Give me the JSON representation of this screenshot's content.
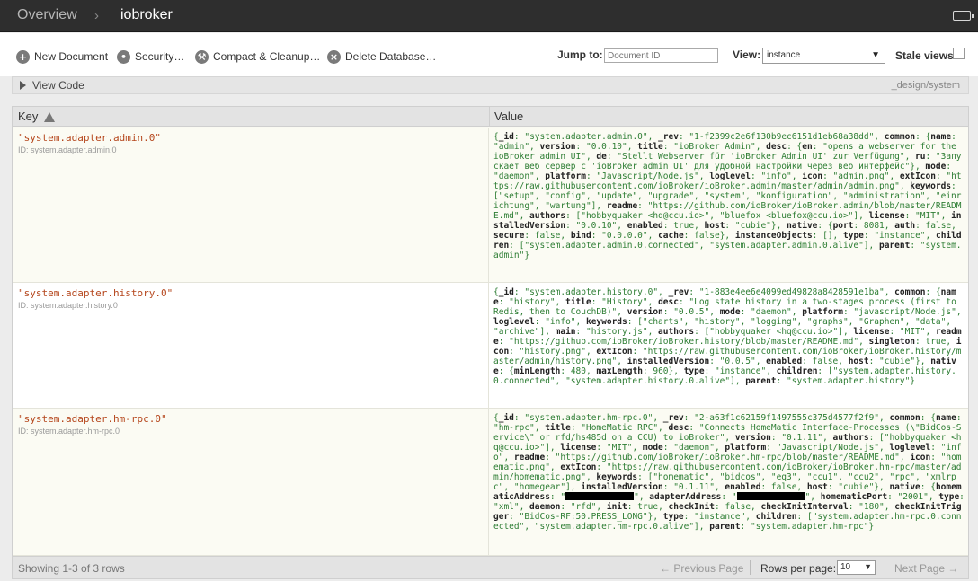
{
  "header": {
    "breadcrumb_root": "Overview",
    "separator": "›",
    "database": "iobroker"
  },
  "toolbar": {
    "new_document": "New Document",
    "security": "Security…",
    "compact": "Compact & Cleanup…",
    "delete": "Delete Database…",
    "jump_label": "Jump to:",
    "jump_placeholder": "Document ID",
    "view_label": "View:",
    "view_value": "instance",
    "stale_label": "Stale views"
  },
  "viewcode": {
    "label": "View Code",
    "design_path": "_design/system"
  },
  "table": {
    "col_key": "Key",
    "col_value": "Value",
    "rows": [
      {
        "key": "\"system.adapter.admin.0\"",
        "id": "ID: system.adapter.admin.0"
      },
      {
        "key": "\"system.adapter.history.0\"",
        "id": "ID: system.adapter.history.0"
      },
      {
        "key": "\"system.adapter.hm-rpc.0\"",
        "id": "ID: system.adapter.hm-rpc.0"
      }
    ],
    "values": [
      [
        [
          "{",
          false
        ],
        [
          "_id",
          true
        ],
        [
          ": \"system.adapter.admin.0\", ",
          false
        ],
        [
          "_rev",
          true
        ],
        [
          ": \"1-f2399c2e6f130b9ec6151d1eb68a38dd\", ",
          false
        ],
        [
          "common",
          true
        ],
        [
          ": {",
          false
        ],
        [
          "name",
          true
        ],
        [
          ": \"admin\", ",
          false
        ],
        [
          "version",
          true
        ],
        [
          ": \"0.0.10\", ",
          false
        ],
        [
          "title",
          true
        ],
        [
          ": \"ioBroker Admin\", ",
          false
        ],
        [
          "desc",
          true
        ],
        [
          ": {",
          false
        ],
        [
          "en",
          true
        ],
        [
          ": \"opens a webserver for the ioBroker admin UI\", ",
          false
        ],
        [
          "de",
          true
        ],
        [
          ": \"Stellt Webserver für 'ioBroker Admin UI' zur Verfügung\", ",
          false
        ],
        [
          "ru",
          true
        ],
        [
          ": \"Запускает веб сервер с 'ioBroker admin UI' для удобной настройки через веб интерфейс\"}, ",
          false
        ],
        [
          "mode",
          true
        ],
        [
          ": \"daemon\", ",
          false
        ],
        [
          "platform",
          true
        ],
        [
          ": \"Javascript/Node.js\", ",
          false
        ],
        [
          "loglevel",
          true
        ],
        [
          ": \"info\", ",
          false
        ],
        [
          "icon",
          true
        ],
        [
          ": \"admin.png\", ",
          false
        ],
        [
          "extIcon",
          true
        ],
        [
          ": \"https://raw.githubusercontent.com/ioBroker/ioBroker.admin/master/admin/admin.png\", ",
          false
        ],
        [
          "keywords",
          true
        ],
        [
          ": [\"setup\", \"config\", \"update\", \"upgrade\", \"system\", \"konfiguration\", \"administration\", \"einrichtung\", \"wartung\"], ",
          false
        ],
        [
          "readme",
          true
        ],
        [
          ": \"https://github.com/ioBroker/ioBroker.admin/blob/master/README.md\", ",
          false
        ],
        [
          "authors",
          true
        ],
        [
          ": [\"hobbyquaker <hq@ccu.io>\", \"bluefox <bluefox@ccu.io>\"], ",
          false
        ],
        [
          "license",
          true
        ],
        [
          ": \"MIT\", ",
          false
        ],
        [
          "installedVersion",
          true
        ],
        [
          ": \"0.0.10\", ",
          false
        ],
        [
          "enabled",
          true
        ],
        [
          ": true, ",
          false
        ],
        [
          "host",
          true
        ],
        [
          ": \"cubie\"}, ",
          false
        ],
        [
          "native",
          true
        ],
        [
          ": {",
          false
        ],
        [
          "port",
          true
        ],
        [
          ": 8081, ",
          false
        ],
        [
          "auth",
          true
        ],
        [
          ": false, ",
          false
        ],
        [
          "secure",
          true
        ],
        [
          ": false, ",
          false
        ],
        [
          "bind",
          true
        ],
        [
          ": \"0.0.0.0\", ",
          false
        ],
        [
          "cache",
          true
        ],
        [
          ": false}, ",
          false
        ],
        [
          "instanceObjects",
          true
        ],
        [
          ": [], ",
          false
        ],
        [
          "type",
          true
        ],
        [
          ": \"instance\", ",
          false
        ],
        [
          "children",
          true
        ],
        [
          ": [\"system.adapter.admin.0.connected\", \"system.adapter.admin.0.alive\"], ",
          false
        ],
        [
          "parent",
          true
        ],
        [
          ": \"system.admin\"}",
          false
        ]
      ],
      [
        [
          "{",
          false
        ],
        [
          "_id",
          true
        ],
        [
          ": \"system.adapter.history.0\", ",
          false
        ],
        [
          "_rev",
          true
        ],
        [
          ": \"1-883e4ee6e4099ed49828a8428591e1ba\", ",
          false
        ],
        [
          "common",
          true
        ],
        [
          ": {",
          false
        ],
        [
          "name",
          true
        ],
        [
          ": \"history\", ",
          false
        ],
        [
          "title",
          true
        ],
        [
          ": \"History\", ",
          false
        ],
        [
          "desc",
          true
        ],
        [
          ": \"Log state history in a two-stages process (first to Redis, then to CouchDB)\", ",
          false
        ],
        [
          "version",
          true
        ],
        [
          ": \"0.0.5\", ",
          false
        ],
        [
          "mode",
          true
        ],
        [
          ": \"daemon\", ",
          false
        ],
        [
          "platform",
          true
        ],
        [
          ": \"javascript/Node.js\", ",
          false
        ],
        [
          "loglevel",
          true
        ],
        [
          ": \"info\", ",
          false
        ],
        [
          "keywords",
          true
        ],
        [
          ": [\"charts\", \"history\", \"logging\", \"graphs\", \"Graphen\", \"data\", \"archive\"], ",
          false
        ],
        [
          "main",
          true
        ],
        [
          ": \"history.js\", ",
          false
        ],
        [
          "authors",
          true
        ],
        [
          ": [\"hobbyquaker <hq@ccu.io>\"], ",
          false
        ],
        [
          "license",
          true
        ],
        [
          ": \"MIT\", ",
          false
        ],
        [
          "readme",
          true
        ],
        [
          ": \"https://github.com/ioBroker/ioBroker.history/blob/master/README.md\", ",
          false
        ],
        [
          "singleton",
          true
        ],
        [
          ": true, ",
          false
        ],
        [
          "icon",
          true
        ],
        [
          ": \"history.png\", ",
          false
        ],
        [
          "extIcon",
          true
        ],
        [
          ": \"https://raw.githubusercontent.com/ioBroker/ioBroker.history/master/admin/history.png\", ",
          false
        ],
        [
          "installedVersion",
          true
        ],
        [
          ": \"0.0.5\", ",
          false
        ],
        [
          "enabled",
          true
        ],
        [
          ": false, ",
          false
        ],
        [
          "host",
          true
        ],
        [
          ": \"cubie\"}, ",
          false
        ],
        [
          "native",
          true
        ],
        [
          ": {",
          false
        ],
        [
          "minLength",
          true
        ],
        [
          ": 480, ",
          false
        ],
        [
          "maxLength",
          true
        ],
        [
          ": 960}, ",
          false
        ],
        [
          "type",
          true
        ],
        [
          ": \"instance\", ",
          false
        ],
        [
          "children",
          true
        ],
        [
          ": [\"system.adapter.history.0.connected\", \"system.adapter.history.0.alive\"], ",
          false
        ],
        [
          "parent",
          true
        ],
        [
          ": \"system.adapter.history\"}",
          false
        ]
      ],
      [
        [
          "{",
          false
        ],
        [
          "_id",
          true
        ],
        [
          ": \"system.adapter.hm-rpc.0\", ",
          false
        ],
        [
          "_rev",
          true
        ],
        [
          ": \"2-a63f1c62159f1497555c375d4577f2f9\", ",
          false
        ],
        [
          "common",
          true
        ],
        [
          ": {",
          false
        ],
        [
          "name",
          true
        ],
        [
          ": \"hm-rpc\", ",
          false
        ],
        [
          "title",
          true
        ],
        [
          ": \"HomeMatic RPC\", ",
          false
        ],
        [
          "desc",
          true
        ],
        [
          ": \"Connects HomeMatic Interface-Processes (\\\"BidCos-Service\\\" or rfd/hs485d on a CCU) to ioBroker\", ",
          false
        ],
        [
          "version",
          true
        ],
        [
          ": \"0.1.11\", ",
          false
        ],
        [
          "authors",
          true
        ],
        [
          ": [\"hobbyquaker <hq@ccu.io>\"], ",
          false
        ],
        [
          "license",
          true
        ],
        [
          ": \"MIT\", ",
          false
        ],
        [
          "mode",
          true
        ],
        [
          ": \"daemon\", ",
          false
        ],
        [
          "platform",
          true
        ],
        [
          ": \"Javascript/Node.js\", ",
          false
        ],
        [
          "loglevel",
          true
        ],
        [
          ": \"info\", ",
          false
        ],
        [
          "readme",
          true
        ],
        [
          ": \"https://github.com/ioBroker/ioBroker.hm-rpc/blob/master/README.md\", ",
          false
        ],
        [
          "icon",
          true
        ],
        [
          ": \"homematic.png\", ",
          false
        ],
        [
          "extIcon",
          true
        ],
        [
          ": \"https://raw.githubusercontent.com/ioBroker/ioBroker.hm-rpc/master/admin/homematic.png\", ",
          false
        ],
        [
          "keywords",
          true
        ],
        [
          ": [\"homematic\", \"bidcos\", \"eq3\", \"ccu1\", \"ccu2\", \"rpc\", \"xmlrpc\", \"homegear\"], ",
          false
        ],
        [
          "installedVersion",
          true
        ],
        [
          ": \"0.1.11\", ",
          false
        ],
        [
          "enabled",
          true
        ],
        [
          ": false, ",
          false
        ],
        [
          "host",
          true
        ],
        [
          ": \"cubie\"}, ",
          false
        ],
        [
          "native",
          true
        ],
        [
          ": {",
          false
        ],
        [
          "homematicAddress",
          true
        ],
        [
          ": ",
          false
        ],
        [
          "\"",
          false
        ],
        [
          "__REDACT__",
          false
        ],
        [
          "\", ",
          false
        ],
        [
          "adapterAddress",
          true
        ],
        [
          ": ",
          false
        ],
        [
          "\"",
          false
        ],
        [
          "__REDACT__",
          false
        ],
        [
          "\", ",
          false
        ],
        [
          "homematicPort",
          true
        ],
        [
          ": \"2001\", ",
          false
        ],
        [
          "type",
          true
        ],
        [
          ": \"xml\", ",
          false
        ],
        [
          "daemon",
          true
        ],
        [
          ": \"rfd\", ",
          false
        ],
        [
          "init",
          true
        ],
        [
          ": true, ",
          false
        ],
        [
          "checkInit",
          true
        ],
        [
          ": false, ",
          false
        ],
        [
          "checkInitInterval",
          true
        ],
        [
          ": \"180\", ",
          false
        ],
        [
          "checkInitTrigger",
          true
        ],
        [
          ": \"BidCos-RF:50.PRESS_LONG\"}, ",
          false
        ],
        [
          "type",
          true
        ],
        [
          ": \"instance\", ",
          false
        ],
        [
          "children",
          true
        ],
        [
          ": [\"system.adapter.hm-rpc.0.connected\", \"system.adapter.hm-rpc.0.alive\"], ",
          false
        ],
        [
          "parent",
          true
        ],
        [
          ": \"system.adapter.hm-rpc\"}",
          false
        ]
      ]
    ]
  },
  "footer": {
    "count": "Showing 1-3 of 3 rows",
    "prev": "← Previous Page",
    "rows_per_page": "Rows per page:",
    "rows_value": "10",
    "next": "Next Page →"
  },
  "icons": {
    "new_document": "plus-circle-icon",
    "security": "lightbulb-icon",
    "compact": "wrench-icon",
    "delete": "x-circle-icon"
  }
}
